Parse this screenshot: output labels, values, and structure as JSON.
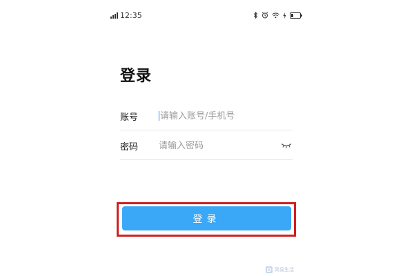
{
  "status_bar": {
    "time": "12:35",
    "icons": [
      "signal-icon",
      "bluetooth-icon",
      "alarm-icon",
      "wifi-icon",
      "charging-icon",
      "battery-icon"
    ]
  },
  "login": {
    "title": "登录",
    "account_label": "账号",
    "account_placeholder": "请输入账号/手机号",
    "password_label": "密码",
    "password_placeholder": "请输入密码",
    "submit_label": "登录"
  },
  "watermark": {
    "text": "简易生活"
  },
  "colors": {
    "button_bg": "#3aa7f7",
    "highlight_border": "#d11f1f",
    "caret": "#2a8cf0"
  }
}
